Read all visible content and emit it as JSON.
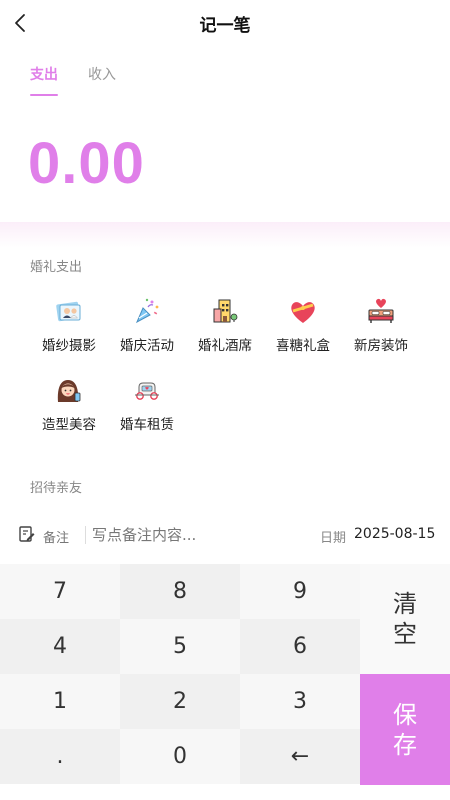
{
  "header": {
    "title": "记一笔"
  },
  "tabs": [
    {
      "label": "支出",
      "active": true
    },
    {
      "label": "收入",
      "active": false
    }
  ],
  "amount": "0.00",
  "accent_color": "#e07fe9",
  "sections": [
    {
      "title": "婚礼支出",
      "items": [
        {
          "label": "婚纱摄影",
          "icon": "wedding-photo-icon"
        },
        {
          "label": "婚庆活动",
          "icon": "party-popper-icon"
        },
        {
          "label": "婚礼酒席",
          "icon": "banquet-hall-icon"
        },
        {
          "label": "喜糖礼盒",
          "icon": "candy-gift-box-icon"
        },
        {
          "label": "新房装饰",
          "icon": "bed-decoration-icon"
        },
        {
          "label": "造型美容",
          "icon": "makeup-styling-icon"
        },
        {
          "label": "婚车租赁",
          "icon": "wedding-car-icon"
        }
      ]
    },
    {
      "title": "招待亲友",
      "items": []
    }
  ],
  "remark": {
    "label": "备注",
    "placeholder": "写点备注内容...",
    "value": ""
  },
  "date": {
    "label": "日期",
    "value": "2025-08-15"
  },
  "keypad": {
    "keys": [
      "7",
      "8",
      "9",
      "4",
      "5",
      "6",
      "1",
      "2",
      "3",
      ".",
      "0",
      "←"
    ],
    "clear_line1": "清",
    "clear_line2": "空",
    "save_line1": "保",
    "save_line2": "存"
  }
}
